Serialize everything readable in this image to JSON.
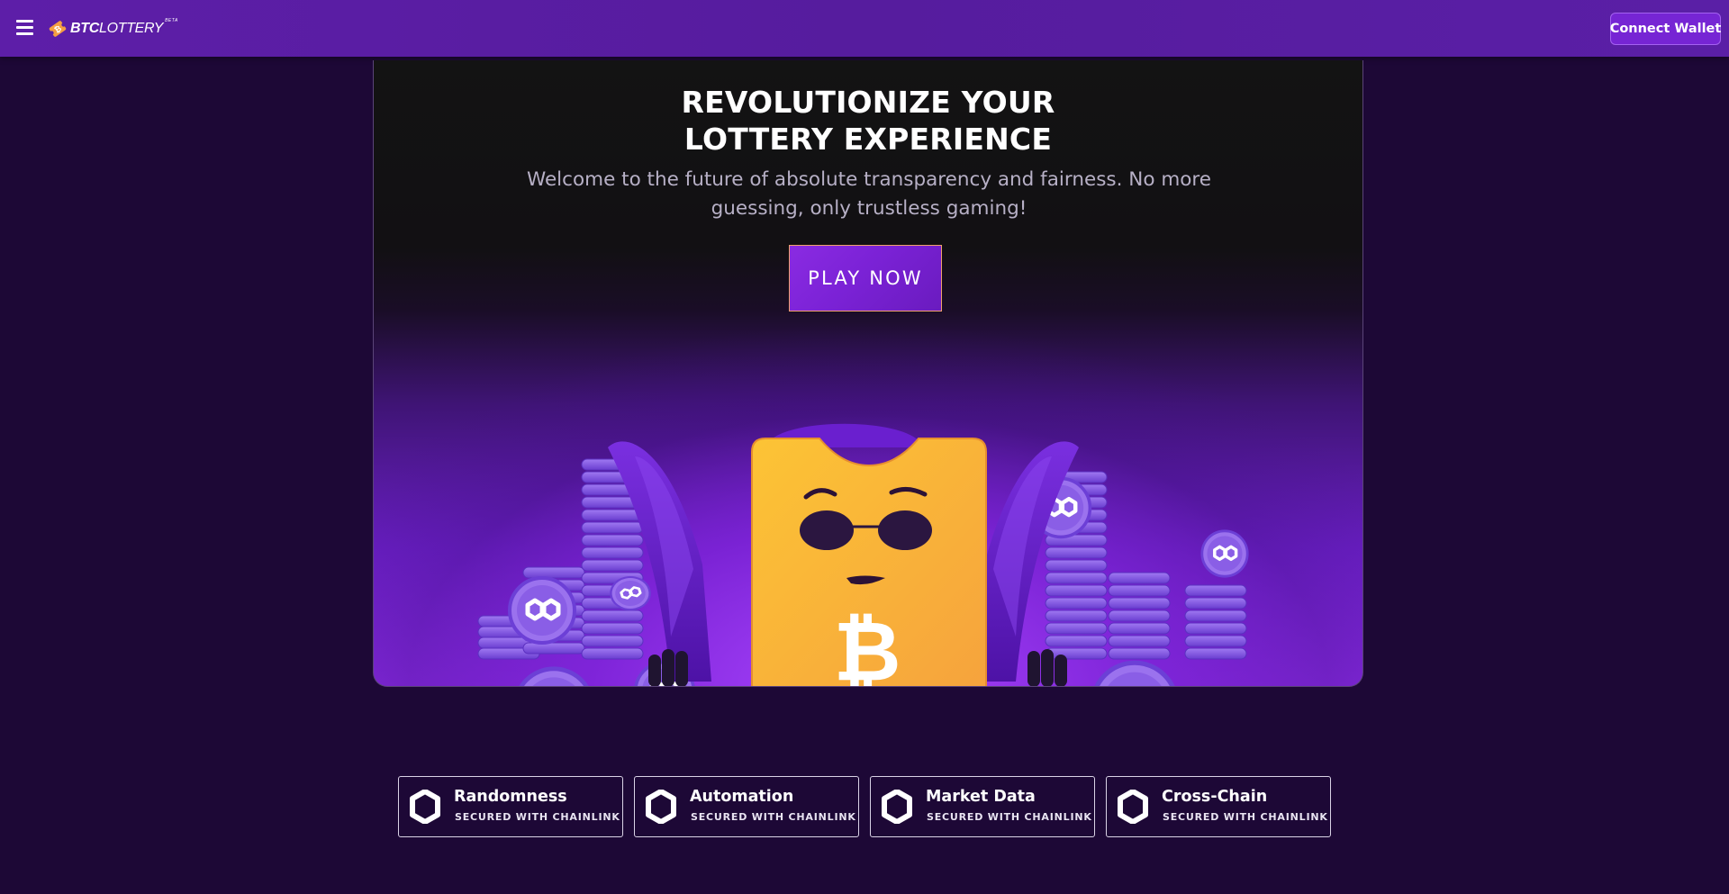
{
  "header": {
    "logo": {
      "brand_bold": "BTC",
      "brand_rest": "LOTTERY",
      "badge": "BETA"
    },
    "connect_wallet_label": "Connect Wallet"
  },
  "hero": {
    "title_line1": "REVOLUTIONIZE YOUR",
    "title_line2": "LOTTERY EXPERIENCE",
    "subtitle_line1": "Welcome to the future of absolute transparency and fairness. No more",
    "subtitle_line2": "guessing, only trustless gaming!",
    "cta_label": "PLAY NOW",
    "illustration": "ticket-mascot-with-coin-stacks"
  },
  "features": [
    {
      "title": "Randomness",
      "subtitle": "SECURED WITH CHAINLINK",
      "icon": "chainlink-hexagon-icon"
    },
    {
      "title": "Automation",
      "subtitle": "SECURED WITH CHAINLINK",
      "icon": "chainlink-hexagon-icon"
    },
    {
      "title": "Market Data",
      "subtitle": "SECURED WITH CHAINLINK",
      "icon": "chainlink-hexagon-icon"
    },
    {
      "title": "Cross-Chain",
      "subtitle": "SECURED WITH CHAINLINK",
      "icon": "chainlink-hexagon-icon"
    }
  ],
  "colors": {
    "header_bg": "#5a1fa6",
    "page_bg": "#1d0836",
    "accent": "#7625d4",
    "mascot": "#f5b236",
    "coin": "#8a5ee6"
  }
}
